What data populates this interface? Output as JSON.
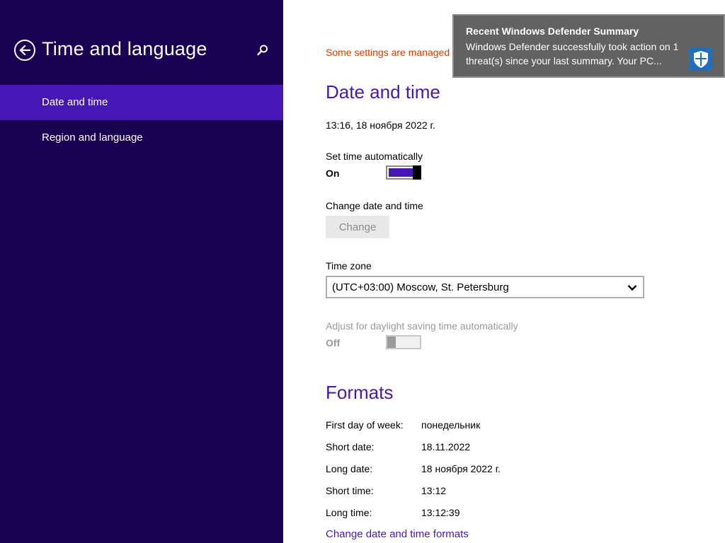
{
  "sidebar": {
    "title": "Time and language",
    "items": [
      {
        "label": "Date and time",
        "active": true
      },
      {
        "label": "Region and language",
        "active": false
      }
    ]
  },
  "main": {
    "managed_notice": "Some settings are managed",
    "date_time": {
      "heading": "Date and time",
      "current": "13:16, 18 ноября 2022 г.",
      "set_auto_label": "Set time automatically",
      "set_auto_state": "On",
      "change_label": "Change date and time",
      "change_button": "Change",
      "timezone_label": "Time zone",
      "timezone_value": "(UTC+03:00) Moscow, St. Petersburg",
      "dst_label": "Adjust for daylight saving time automatically",
      "dst_state": "Off"
    },
    "formats": {
      "heading": "Formats",
      "rows": [
        {
          "label": "First day of week:",
          "value": "понедельник"
        },
        {
          "label": "Short date:",
          "value": "18.11.2022"
        },
        {
          "label": "Long date:",
          "value": "18 ноября 2022 г."
        },
        {
          "label": "Short time:",
          "value": "13:12"
        },
        {
          "label": "Long time:",
          "value": "13:12:39"
        }
      ],
      "link": "Change date and time formats"
    }
  },
  "toast": {
    "title": "Recent Windows Defender Summary",
    "body": "Windows Defender successfully took action on 1 threat(s) since your last summary. Your PC...",
    "icon": "windows-defender-shield-icon"
  },
  "colors": {
    "sidebar_bg": "#180052",
    "accent": "#4617b4",
    "warning": "#d83b01",
    "toast_bg": "#626262"
  }
}
